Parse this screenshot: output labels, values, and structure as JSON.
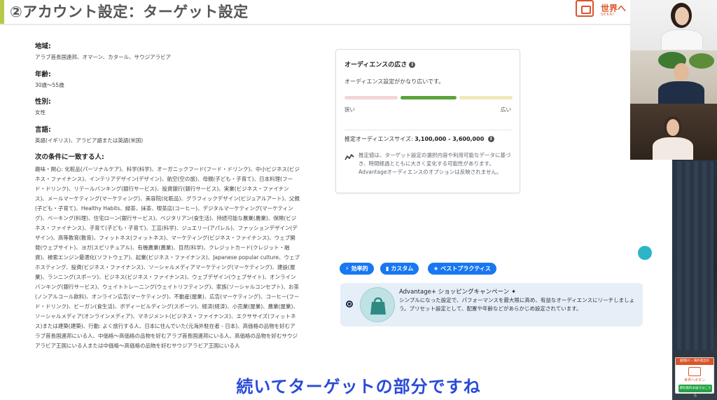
{
  "slide": {
    "title": "②アカウント設定：ターゲット設定",
    "logo_text": "世界へ",
    "logo_sub": "SEKAI"
  },
  "targeting": {
    "location_label": "地域:",
    "location_value": "アラブ首長国連邦、オマーン、カタール、サウジアラビア",
    "age_label": "年齢:",
    "age_value": "30歳〜55歳",
    "gender_label": "性別:",
    "gender_value": "女性",
    "language_label": "言語:",
    "language_value": "英語(イギリス)、アラビア語または英語(米国)",
    "interests_label": "次の条件に一致する人:",
    "interests_value": "趣味・関心: 化粧品(パーソナルケア)、科学(科学)、オーガニックフード(フード・ドリンク)、中小ビジネス(ビジネス・ファイナンス)、インテリアデザイン(デザイン)、航空(空の旅)、母親(子ども・子育て)、日本料理(フード・ドリンク)、リテールバンキング(銀行サービス)、投資銀行(銀行サービス)、実業(ビジネス・ファイナンス)、メールマーケティング(マーケティング)、美容院(化粧品)、グラフィックデザイン(ビジュアルアート)、父親(子ども・子育て)、Healthy Habits、緑茶、抹茶、喫茶店(コーヒー)、デジタルマーケティング(マーケティング)、ベーキング(料理)、住宅ローン(銀行サービス)、ベジタリアン(食生活)、持続可能な農業(農業)、保険(ビジネス・ファイナンス)、子育て(子ども・子育て)、工芸(科学)、ジュエリー(アパレル)、ファッションデザイン(デザイン)、高等教育(教育)、フィットネス(フィットネス)、マーケティング(ビジネス・ファイナンス)、ウェブ開発(ウェブサイト)、ヨガ(スピリチュアル)、有機農業(農業)、目然(科学)、クレジットカード(クレジット・融資)、検索エンジン最適化(ソフトウェア)、起業(ビジネス・ファイナンス)、Japanese popular culture、ウェブホスティング、投資(ビジネス・ファイナンス)、ソーシャルメディアマーケティング(マーケティング)、建設(屋業)、ランニング(スポーツ)、ビジネス(ビジネス・ファイナンス)、ウェブデザイン(ウェブサイト)、オンラインバンキング(銀行サービス)、ウェイトトレーニング(ウェイトリフティング)、家族(ソーシャルコンセプト)、お茶(ノンアルコール飲料)、オンライン広告(マーケティング)、不動産(屋業)、広告(マーケティング)、コーヒー(フード・ドリンク)、ビーガン(食生活)、ボディービルディング(スポーツ)、経済(経済)、小売業(屋業)、農業(屋業)、ソーシャルメディア(オンラインメディア)、マネジメント(ビジネス・ファイナンス)、エクササイズ(フィットネス)または建築(建築)、行動: よく旅行する人、日本に住んでいた(元海外駐在者 - 日本)、高価格の品物を好むアラブ首長国連邦にいる人、中価格〜高価格の品物を好むアラブ首長国連邦にいる人、高価格の品物を好むサウジアラビア王国にいる人または中価格〜高価格の品物を好むサウジアラビア王国にいる人"
  },
  "audience": {
    "title": "オーディエンスの広さ",
    "info_icon": "i",
    "status": "オーディエンス設定がかなり広いです。",
    "narrow_label": "狭い",
    "broad_label": "広い",
    "size_label": "推定オーディエンスサイズ:",
    "size_value": "3,100,000 - 3,600,000",
    "note": "推定値は、ターゲット設定の選択内容や利用可能なデータに基づき、時間経過とともに大きく変化する可能性があります。Advantageオーディエンスのオプションは反映されません。",
    "level": 0.55
  },
  "pills": {
    "efficient": "効率的",
    "custom": "カスタム",
    "best_practices": "ベストプラクティス"
  },
  "campaign": {
    "title": "Advantage+ ショッピングキャンペーン",
    "desc": "シンプルになった設定で、パフォーマンスを最大限に高め、有益なオーディエンスにリーチしましょう。プリセット設定として、配置や年齢などがあらかじめ設定されています。"
  },
  "side": {
    "promo_top": "越境EC・海外進出の",
    "promo_name": "世界へボタン",
    "promo_button": "資料無料お届けはこちら"
  },
  "subtitle": "続いてターゲットの部分ですね",
  "colors": {
    "accent_blue": "#1877f2",
    "subtitle_blue": "#2a4bd7",
    "brand_orange": "#d9552b",
    "meter_green": "#5aa33a",
    "teal": "#2bb5c6"
  }
}
